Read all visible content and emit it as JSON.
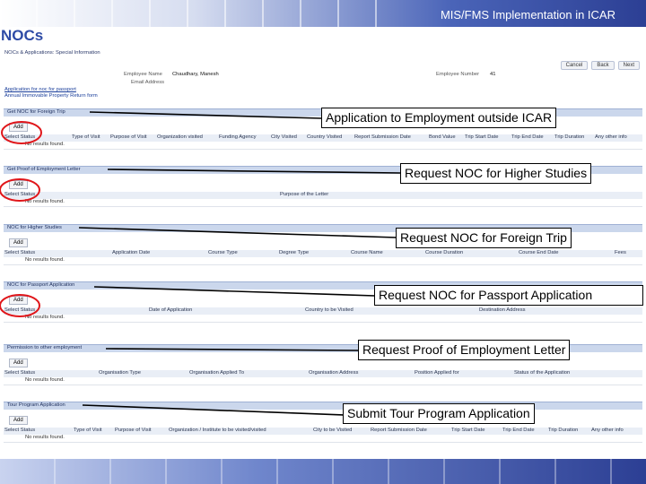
{
  "banner": {
    "title": "MIS/FMS Implementation in ICAR"
  },
  "page_title": "NOCs",
  "app": {
    "subtitle": "NOCs & Applications: Special Information",
    "buttons": [
      "Cancel",
      "Back",
      "Next"
    ],
    "employee_name_label": "Employee Name",
    "employee_name_value": "Chaudhary, Manesh",
    "email_label": "Email Address",
    "employee_number_label": "Employee Number",
    "employee_number_value": "41",
    "links": [
      "Application for noc for passport",
      "Annual Immovable Property Return form"
    ]
  },
  "sections": [
    {
      "title": "Get NOC for Foreign Trip",
      "add": "Add",
      "columns": [
        "Select Status",
        "Type of Visit",
        "Purpose of Visit",
        "Organization visited",
        "Funding Agency",
        "City Visited",
        "Country Visited",
        "Report Submission Date",
        "Bond Value",
        "Trip Start Date",
        "Trip End Date",
        "Trip Duration",
        "Any other info"
      ],
      "no_results": "No results found."
    },
    {
      "title": "Get Proof of Employment Letter",
      "add": "Add",
      "columns": [
        "Select Status",
        "Purpose of the Letter"
      ],
      "no_results": "No results found."
    },
    {
      "title": "NOC for Higher Studies",
      "add": "Add",
      "columns": [
        "Select Status",
        "Application Date",
        "Course Type",
        "Degree Type",
        "Course Name",
        "Course Duration",
        "Course End Date",
        "Fees"
      ],
      "no_results": "No results found."
    },
    {
      "title": "NOC for Passport Application",
      "add": "Add",
      "columns": [
        "Select Status",
        "Date of Application",
        "Country to be Visited",
        "Destination Address"
      ],
      "no_results": "No results found."
    },
    {
      "title": "Permission to other employment",
      "add": "Add",
      "columns": [
        "Select Status",
        "Organisation Type",
        "Organisation Applied To",
        "Organisation Address",
        "Position Applied for",
        "Status of the Application"
      ],
      "no_results": "No results found."
    },
    {
      "title": "Tour Program Application",
      "add": "Add",
      "columns": [
        "Select Status",
        "Type of Visit",
        "Purpose of Visit",
        "Organization / Institute to be visited/visited",
        "City to be Visited",
        "Report Submission Date",
        "Trip Start Date",
        "Trip End Date",
        "Trip Duration",
        "Any other info"
      ],
      "no_results": "No results found."
    }
  ],
  "callouts": [
    "Application to Employment outside ICAR",
    "Request NOC for Higher Studies",
    "Request NOC for Foreign Trip",
    "Request NOC for Passport Application",
    "Request Proof of Employment Letter",
    "Submit Tour Program Application"
  ],
  "colors": {
    "accent": "#2e4ba6",
    "highlight_circle": "#e0161a",
    "section_header": "#cbd7ec"
  }
}
